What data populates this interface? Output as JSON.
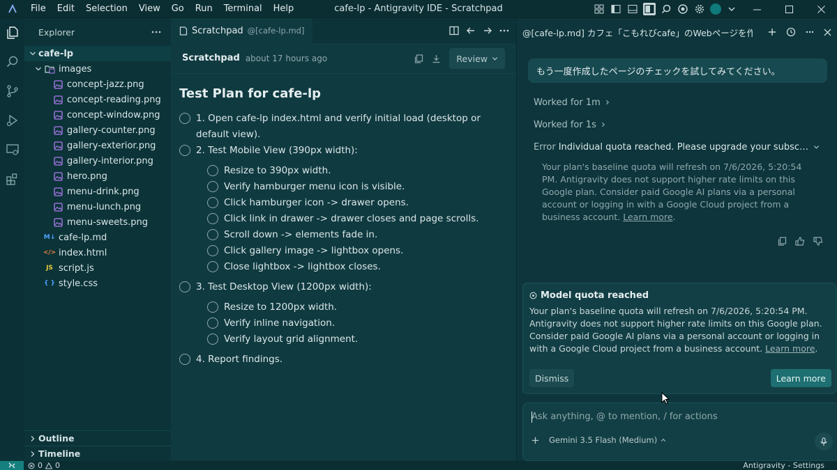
{
  "titlebar": {
    "menus": [
      "File",
      "Edit",
      "Selection",
      "View",
      "Go",
      "Run",
      "Terminal",
      "Help"
    ],
    "window_title": "cafe-lp - Antigravity IDE - Scratchpad"
  },
  "explorer": {
    "header": "Explorer",
    "root": "cafe-lp",
    "folder": "images",
    "images": [
      "concept-jazz.png",
      "concept-reading.png",
      "concept-window.png",
      "gallery-counter.png",
      "gallery-exterior.png",
      "gallery-interior.png",
      "hero.png",
      "menu-drink.png",
      "menu-lunch.png",
      "menu-sweets.png"
    ],
    "files": [
      {
        "name": "cafe-lp.md",
        "icon": "M↓",
        "type": "md"
      },
      {
        "name": "index.html",
        "icon": "</>",
        "type": "html"
      },
      {
        "name": "script.js",
        "icon": "JS",
        "type": "js"
      },
      {
        "name": "style.css",
        "icon": "{ }",
        "type": "css"
      }
    ],
    "outline": "Outline",
    "timeline": "Timeline"
  },
  "editor": {
    "tab_title": "Scratchpad",
    "tab_sub": "@[cafe-lp.md]",
    "doc_name": "Scratchpad",
    "doc_time": "about 17 hours ago",
    "review_label": "Review",
    "doc_title": "Test Plan for cafe-lp",
    "steps": {
      "s1": "1. Open cafe-lp index.html and verify initial load (desktop or default view).",
      "s2": "2. Test Mobile View (390px width):",
      "s2_items": [
        "Resize to 390px width.",
        "Verify hamburger menu icon is visible.",
        "Click hamburger icon -> drawer opens.",
        "Click link in drawer -> drawer closes and page scrolls.",
        "Scroll down -> elements fade in.",
        "Click gallery image -> lightbox opens.",
        "Close lightbox -> lightbox closes."
      ],
      "s3": "3. Test Desktop View (1200px width):",
      "s3_items": [
        "Resize to 1200px width.",
        "Verify inline navigation.",
        "Verify layout grid alignment."
      ],
      "s4": "4. Report findings."
    }
  },
  "chat": {
    "title": "@[cafe-lp.md] カフェ「こもれびcafe」のWebページを作",
    "user_message": "もう一度作成したページのチェックを試してみてください。",
    "worked_1": "Worked for 1m",
    "worked_2": "Worked for 1s",
    "error_label": "Error",
    "error_text": "Individual quota reached. Please upgrade your subscription to increase your quota.",
    "error_detail": "Your plan's baseline quota will refresh on 7/6/2026, 5:20:54 PM. Antigravity does not support higher rate limits on this Google plan. Consider paid Google AI plans via a personal account or logging in with a Google Cloud project from a business account.",
    "learn_more_link": "Learn more",
    "quota_card": {
      "title": "Model quota reached",
      "text": "Your plan's baseline quota will refresh on 7/6/2026, 5:20:54 PM. Antigravity does not support higher rate limits on this Google plan. Consider paid Google AI plans via a personal account or logging in with a Google Cloud project from a business account.",
      "link": "Learn more",
      "dismiss": "Dismiss",
      "learn_more": "Learn more"
    },
    "input_placeholder": "Ask anything, @ to mention, / for actions",
    "model": "Gemini 3.5 Flash (Medium)"
  },
  "statusbar": {
    "errors": "0",
    "warnings": "0",
    "right_text": "Antigravity - Settings"
  },
  "colors": {
    "background": "#0f3a40",
    "accent": "#1d6f71",
    "remote": "#16807e"
  }
}
